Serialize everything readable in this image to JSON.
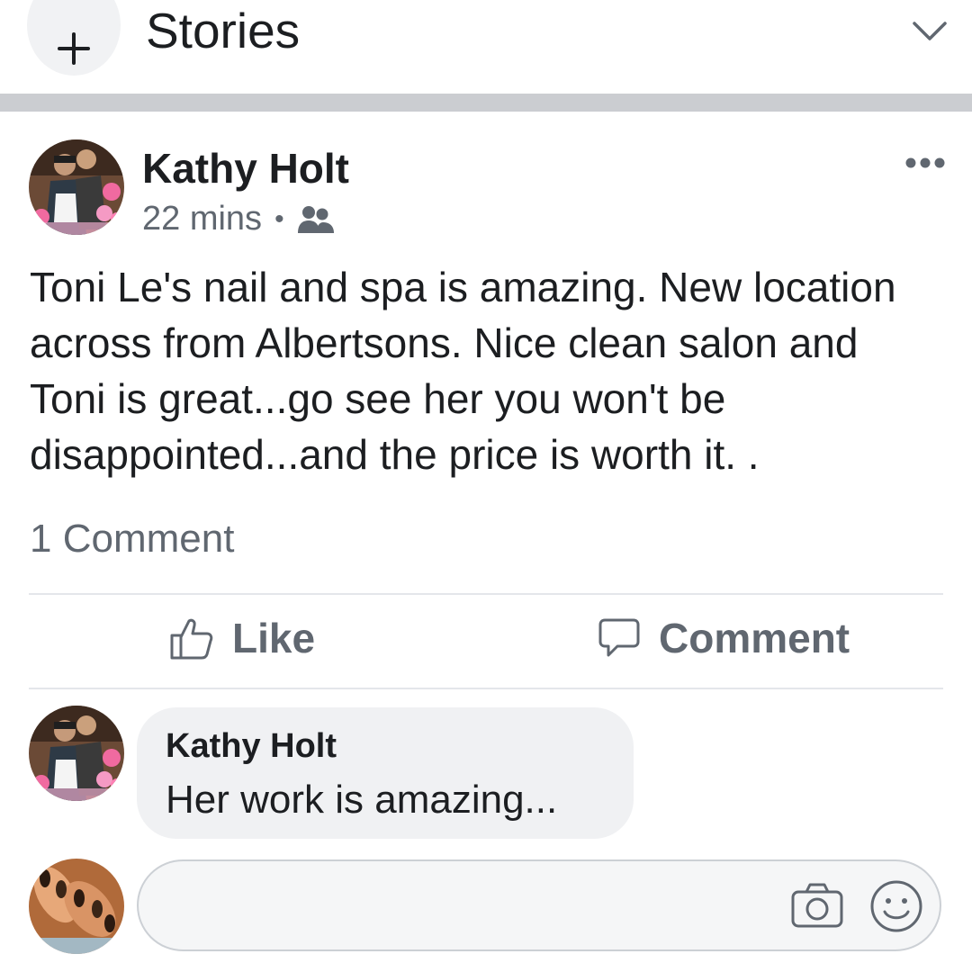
{
  "stories": {
    "plus_icon": "plus-icon",
    "title": "Stories",
    "chevron_icon": "chevron-down-icon"
  },
  "post": {
    "author": "Kathy Holt",
    "time": "22 mins",
    "audience_icon": "friends-icon",
    "more_icon": "more-dots-icon",
    "text": "Toni Le's nail and spa is amazing. New location across from Albertsons. Nice clean salon and Toni is great...go see her you won't be disappointed...and the price is worth it.  .",
    "comment_count": "1 Comment"
  },
  "actions": {
    "like_label": "Like",
    "comment_label": "Comment"
  },
  "comment": {
    "author": "Kathy Holt",
    "text": "Her work is amazing..."
  },
  "composer": {
    "camera_icon": "camera-icon",
    "emoji_icon": "emoji-icon"
  },
  "colors": {
    "text_primary": "#1c1e21",
    "text_secondary": "#606770",
    "separator": "#cbcdd1",
    "bubble": "#f0f1f3"
  }
}
